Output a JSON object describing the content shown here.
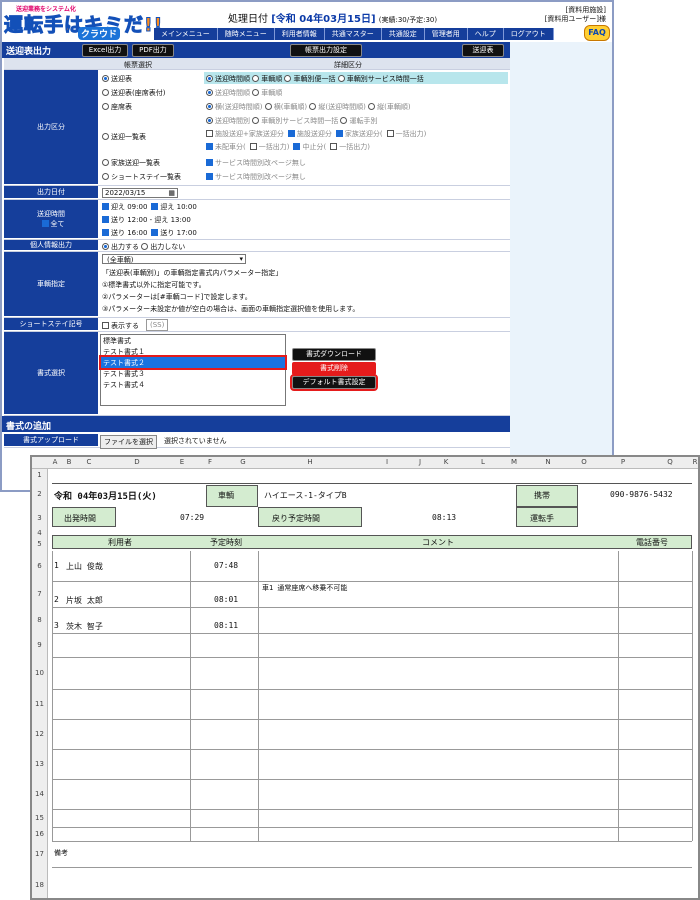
{
  "app": {
    "logo": {
      "tagline": "送迎業務をシステム化",
      "main": "運転手はキミだ!!",
      "sub": "クラウド"
    },
    "date": {
      "label": "処理日付",
      "value": "[令和 04年03月15日]",
      "stats": "(実績:30/予定:30)"
    },
    "user": {
      "facility": "[資料用施設]",
      "name": "[資料用ユーザー]様"
    },
    "nav": [
      "メインメニュー",
      "随時メニュー",
      "利用者情報",
      "共通マスター",
      "共通設定",
      "管理者用",
      "ヘルプ",
      "ログアウト"
    ],
    "faq": "FAQ",
    "bar": {
      "title": "送迎表出力",
      "excel": "Excel出力",
      "pdf": "PDF出力",
      "form_setting": "帳票出力設定",
      "sogei": "送迎表"
    },
    "cols": {
      "left": "帳票選択",
      "right": "詳細区分"
    },
    "output": {
      "label": "出力区分",
      "r1": "送迎表",
      "r1d": [
        "送迎時間順",
        "車輌順",
        "車輌別便一括",
        "車輌別サービス時間一括"
      ],
      "r2": "送迎表(座席表付)",
      "r2d": [
        "送迎時間順",
        "車輌順"
      ],
      "r3": "座席表",
      "r3d": [
        "横(送迎時間順)",
        "横(車輌順)",
        "縦(送迎時間順)",
        "縦(車輌順)"
      ],
      "r4": "送迎一覧表",
      "r4d1": [
        "送迎時間別",
        "車輌別サービス時間一括",
        "運転手別"
      ],
      "r4d2": [
        "施設送迎+家族送迎分",
        "施設送迎分",
        "家族送迎分(",
        "一括出力",
        ")"
      ],
      "r4d3": [
        "未配車分(",
        "一括出力",
        ")",
        "中止分(",
        "一括出力",
        ")"
      ],
      "r5": "家族送迎一覧表",
      "r5d": "サービス時間別改ページ無し",
      "r6": "ショートステイ一覧表",
      "r6d": "サービス時間別改ページ無し"
    },
    "outdate": {
      "label": "出力日付",
      "value": "2022/03/15"
    },
    "times": {
      "label": "送迎時間",
      "all": "全て",
      "t1": "迎え 09:00",
      "t2": "迎え 10:00",
      "t3": "送り 12:00 - 迎え 13:00",
      "t4": "送り 16:00",
      "t5": "送り 17:00"
    },
    "personal": {
      "label": "個人情報出力",
      "on": "出力する",
      "off": "出力しない"
    },
    "vehicle": {
      "label": "車輌指定",
      "select": "(全車輌)",
      "n0": "「送迎表(車輌別)」の車輌指定書式内パラメーター指定」",
      "n1": "①標準書式以外に指定可能です。",
      "n2": "②パラメーターは[#車輌コード]で設定します。",
      "n3": "③パラメーター未設定か値が空白の場合は、画面の車輌指定選択値を使用します。"
    },
    "short": {
      "label": "ショートステイ記号",
      "show": "表示する",
      "code": "(SS)"
    },
    "format": {
      "label": "書式選択",
      "items": [
        "標準書式",
        "テスト書式１",
        "テスト書式２",
        "テスト書式３",
        "テスト書式４"
      ],
      "download": "書式ダウンロード",
      "delete": "書式削除",
      "default": "デフォルト書式設定"
    },
    "add": {
      "title": "書式の追加",
      "upload": "書式アップロード",
      "file": "ファイルを選択",
      "nofile": "選択されていません"
    }
  },
  "sheet": {
    "cols": [
      "A",
      "B",
      "C",
      "D",
      "E",
      "F",
      "G",
      "H",
      "I",
      "J",
      "K",
      "L",
      "M",
      "N",
      "O",
      "P",
      "Q",
      "R"
    ],
    "date": "令和 04年03月15日(火)",
    "car_label": "車輌",
    "car": "ハイエース-1-タイプB",
    "mobile_label": "携帯",
    "mobile": "090-9876-5432",
    "dep_label": "出発時間",
    "dep": "07:29",
    "ret_label": "戻り予定時間",
    "ret": "08:13",
    "driver_label": "運転手",
    "h_user": "利用者",
    "h_time": "予定時刻",
    "h_comment": "コメント",
    "h_tel": "電話番号",
    "rows": [
      {
        "n": "1",
        "name": "上山 俊哉",
        "time": "07:48",
        "comment": ""
      },
      {
        "n": "2",
        "name": "片坂 太郎",
        "time": "08:01",
        "comment": "車1 通常座席へ移乗不可能"
      },
      {
        "n": "3",
        "name": "茨木 智子",
        "time": "08:11",
        "comment": ""
      }
    ],
    "note": "備考"
  }
}
